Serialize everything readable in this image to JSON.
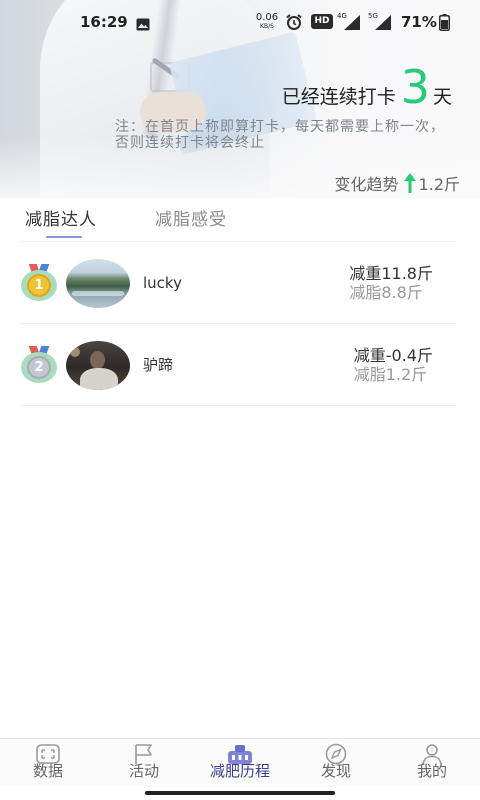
{
  "status_bar": {
    "time": "16:29",
    "net_speed_value": "0.06",
    "net_speed_unit": "KB/S",
    "hd_label": "HD",
    "signal_1_label": "4G",
    "signal_2_label": "5G",
    "battery_percent": "71%",
    "icons": [
      "gallery-icon",
      "alarm-icon",
      "signal-icon",
      "signal-icon",
      "battery-icon"
    ]
  },
  "header": {
    "streak_prefix": "已经连续打卡",
    "streak_days": "3",
    "streak_suffix": "天",
    "note_line_1": "注：在首页上称即算打卡，每天都需要上称一次，",
    "note_line_2": "否则连续打卡将会终止",
    "trend_label": "变化趋势",
    "trend_icon": "arrow-up-icon",
    "trend_value": "1.2斤"
  },
  "tabs": [
    {
      "label": "减脂达人",
      "active": true
    },
    {
      "label": "减脂感受",
      "active": false
    }
  ],
  "ranking": [
    {
      "rank": "1",
      "medal": "gold-medal-icon",
      "name": "lucky",
      "weight_change": "减重11.8斤",
      "fat_change": "减脂8.8斤"
    },
    {
      "rank": "2",
      "medal": "silver-medal-icon",
      "name": "驴蹄",
      "weight_change": "减重-0.4斤",
      "fat_change": "减脂1.2斤"
    }
  ],
  "bottom_nav": [
    {
      "label": "数据",
      "icon": "data-icon",
      "active": false
    },
    {
      "label": "活动",
      "icon": "flag-icon",
      "active": false
    },
    {
      "label": "减肥历程",
      "icon": "scale-icon",
      "active": true
    },
    {
      "label": "发现",
      "icon": "compass-icon",
      "active": false
    },
    {
      "label": "我的",
      "icon": "user-icon",
      "active": false
    }
  ],
  "colors": {
    "accent_green": "#27c97a",
    "active_purple": "#6a6fd0",
    "text_primary": "#333333",
    "text_secondary": "#999999"
  }
}
